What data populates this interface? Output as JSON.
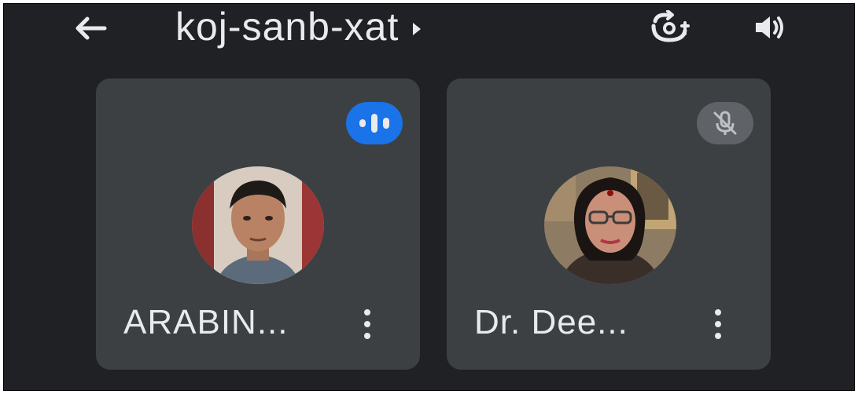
{
  "header": {
    "meeting_code": "koj-sanb-xat",
    "icons": {
      "back": "arrow-left-icon",
      "camera": "switch-camera-icon",
      "speaker": "speaker-icon"
    }
  },
  "participants": [
    {
      "name": "ARABIN...",
      "status": "speaking",
      "status_icon": "audio-levels-icon",
      "status_color": "#1a73e8"
    },
    {
      "name": "Dr. Dee...",
      "status": "muted",
      "status_icon": "mic-off-icon",
      "status_color": "#5f6368"
    }
  ],
  "colors": {
    "background": "#202124",
    "tile": "#3c4043",
    "text": "#e8eaed"
  }
}
